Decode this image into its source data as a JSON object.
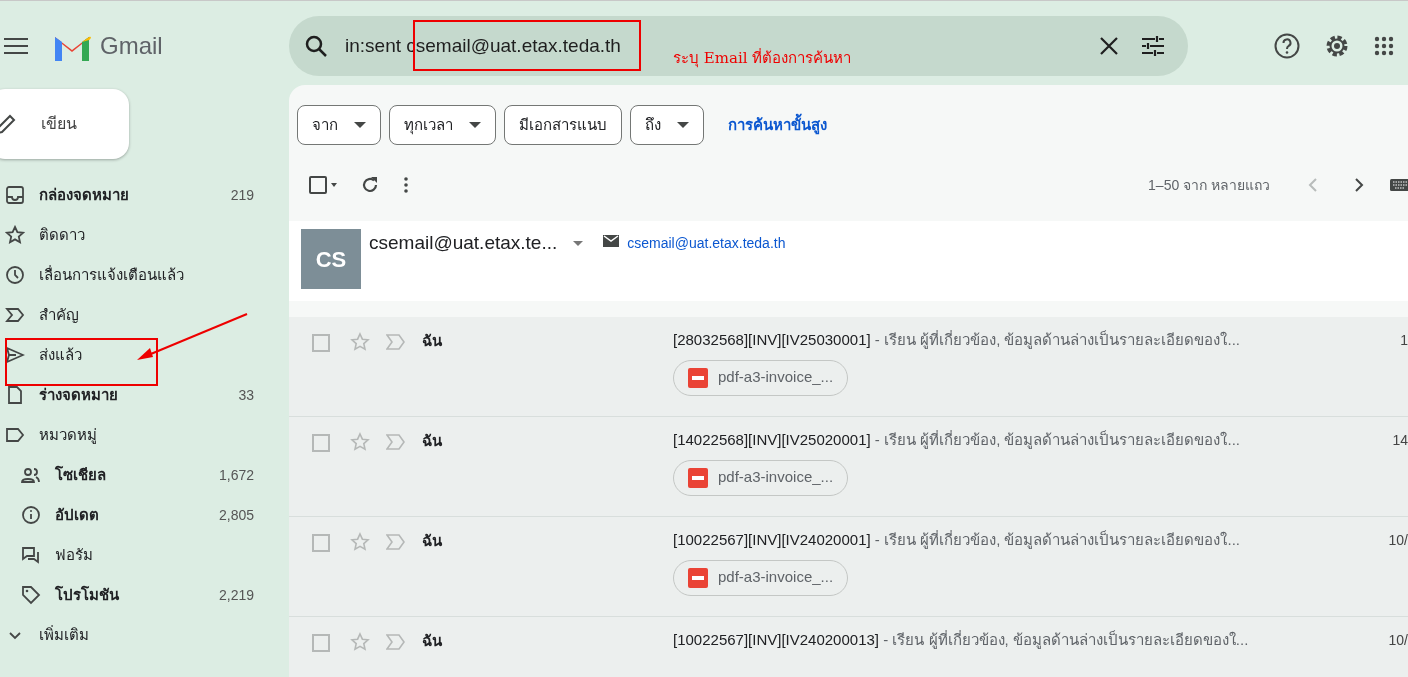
{
  "app": {
    "name": "Gmail"
  },
  "search": {
    "value": "in:sent csemail@uat.etax.teda.th"
  },
  "annotation": {
    "note": "ระบุ Email ที่ต้องการค้นหา"
  },
  "compose": {
    "label": "เขียน"
  },
  "sidebar": {
    "items": [
      {
        "kind": "inbox",
        "label": "กล่องจดหมาย",
        "count": "219",
        "unread": true
      },
      {
        "kind": "starred",
        "label": "ติดดาว",
        "unread": false
      },
      {
        "kind": "snoozed",
        "label": "เลื่อนการแจ้งเตือนแล้ว",
        "unread": false
      },
      {
        "kind": "important",
        "label": "สำคัญ",
        "unread": false
      },
      {
        "kind": "sent",
        "label": "ส่งแล้ว",
        "unread": false
      },
      {
        "kind": "drafts",
        "label": "ร่างจดหมาย",
        "count": "33",
        "unread": true
      },
      {
        "kind": "categories",
        "label": "หมวดหมู่",
        "unread": false,
        "children": [
          {
            "kind": "social",
            "label": "โซเชียล",
            "count": "1,672",
            "unread": true
          },
          {
            "kind": "updates",
            "label": "อัปเดต",
            "count": "2,805",
            "unread": true
          },
          {
            "kind": "forums",
            "label": "ฟอรัม",
            "unread": false
          },
          {
            "kind": "promotions",
            "label": "โปรโมชัน",
            "count": "2,219",
            "unread": true
          }
        ]
      },
      {
        "kind": "more",
        "label": "เพิ่มเติม",
        "unread": false
      }
    ]
  },
  "filters": [
    {
      "label": "จาก",
      "dropdown": true
    },
    {
      "label": "ทุกเวลา",
      "dropdown": true
    },
    {
      "label": "มีเอกสารแนบ",
      "dropdown": false
    },
    {
      "label": "ถึง",
      "dropdown": true
    }
  ],
  "advanced_search": "การค้นหาขั้นสูง",
  "pagination": {
    "range": "1–50 จาก หลายแถว",
    "prev_disabled": true
  },
  "contact": {
    "initials": "CS",
    "name": "csemail@uat.etax.te...",
    "email": "csemail@uat.etax.teda.th"
  },
  "messages": [
    {
      "checked": false,
      "starred": false,
      "sender": "ฉัน",
      "subject": "[28032568][INV][IV25030001]",
      "snippet": "- เรียน ผู้ที่เกี่ยวข้อง, ข้อมูลด้านล่างเป็นรายละเอียดของใ...",
      "attachment": "pdf-a3-invoice_...",
      "date": "1"
    },
    {
      "checked": false,
      "starred": false,
      "sender": "ฉัน",
      "subject": "[14022568][INV][IV25020001]",
      "snippet": "- เรียน ผู้ที่เกี่ยวข้อง, ข้อมูลด้านล่างเป็นรายละเอียดของใ...",
      "attachment": "pdf-a3-invoice_...",
      "date": "14"
    },
    {
      "checked": false,
      "starred": false,
      "sender": "ฉัน",
      "subject": "[10022567][INV][IV24020001]",
      "snippet": "- เรียน ผู้ที่เกี่ยวข้อง, ข้อมูลด้านล่างเป็นรายละเอียดของใ...",
      "attachment": "pdf-a3-invoice_...",
      "date": "10/"
    },
    {
      "checked": false,
      "starred": false,
      "sender": "ฉัน",
      "subject": "[10022567][INV][IV240200013]",
      "snippet": "- เรียน ผู้ที่เกี่ยวข้อง, ข้อมูลด้านล่างเป็นรายละเอียดของใ...",
      "date": "10/"
    }
  ]
}
